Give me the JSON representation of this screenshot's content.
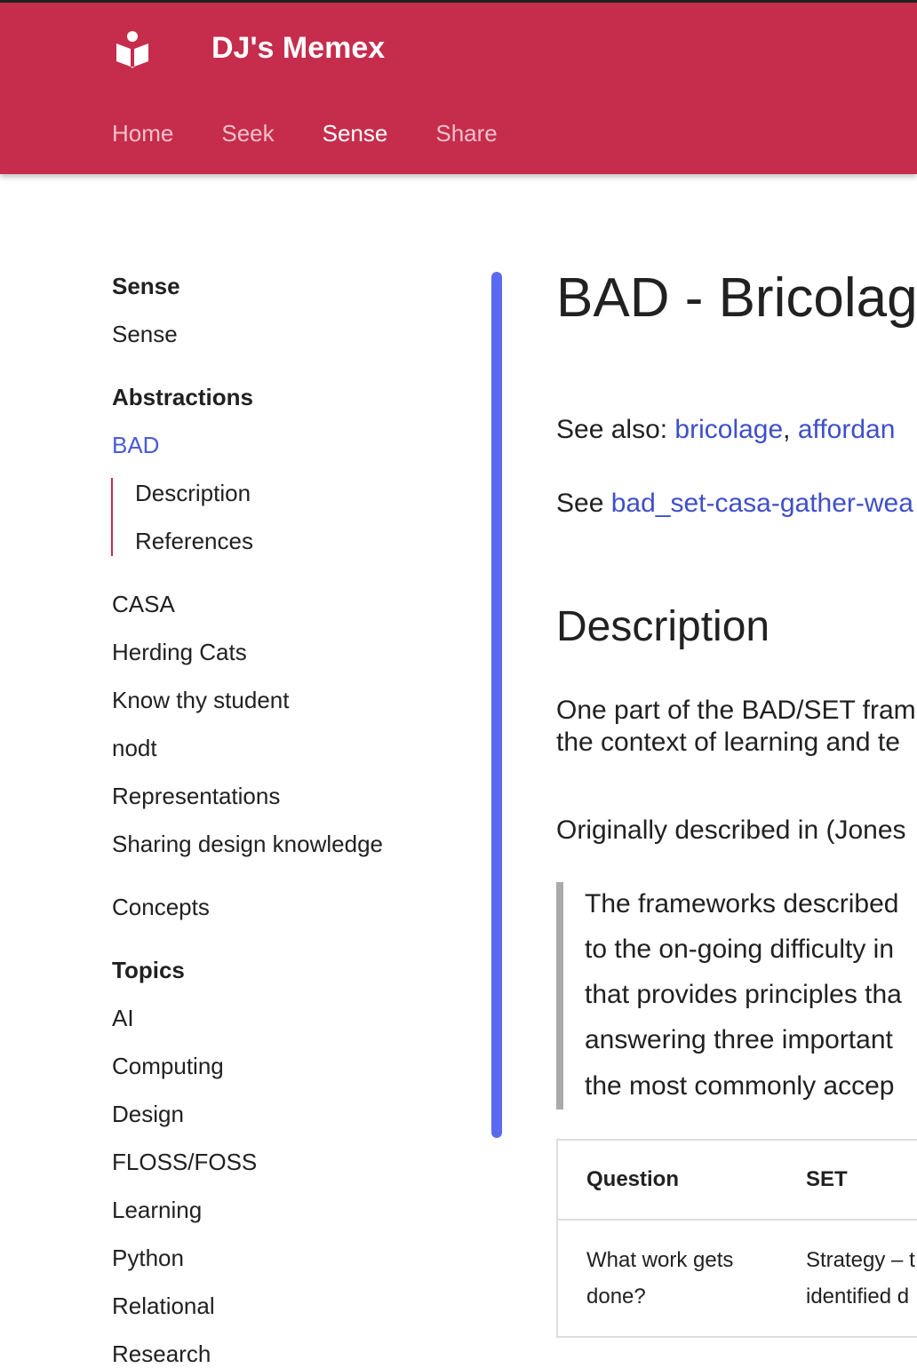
{
  "header": {
    "title": "DJ's Memex",
    "nav": [
      "Home",
      "Seek",
      "Sense",
      "Share"
    ],
    "active": "Sense",
    "color": "#c62c4c"
  },
  "sidebar": {
    "h_sense": "Sense",
    "sense": "Sense",
    "h_abstractions": "Abstractions",
    "bad": "BAD",
    "description": "Description",
    "references": "References",
    "abstractions": [
      "CASA",
      "Herding Cats",
      "Know thy student",
      "nodt",
      "Representations",
      "Sharing design knowledge"
    ],
    "concepts": "Concepts",
    "h_topics": "Topics",
    "topics": [
      "AI",
      "Computing",
      "Design",
      "FLOSS/FOSS",
      "Learning",
      "Python",
      "Relational",
      "Research"
    ]
  },
  "main": {
    "title": "BAD - Bricolage",
    "see_also_label": "See also: ",
    "see_also_links": [
      "bricolage",
      "affordan"
    ],
    "see_label": "See ",
    "see_link": "bad_set-casa-gather-wea",
    "h_description": "Description",
    "p1": [
      "One part of the BAD/SET fram",
      "the context of learning and te"
    ],
    "p2": "Originally described in (Jones",
    "quote": [
      "The frameworks described",
      "to the on-going difficulty in",
      "that provides principles tha",
      "answering three important",
      "the most commonly accep"
    ],
    "table": {
      "headers": [
        "Question",
        "SET"
      ],
      "rows": [
        [
          "What work gets",
          "done?",
          "Strategy – t",
          "identified d"
        ]
      ]
    }
  }
}
